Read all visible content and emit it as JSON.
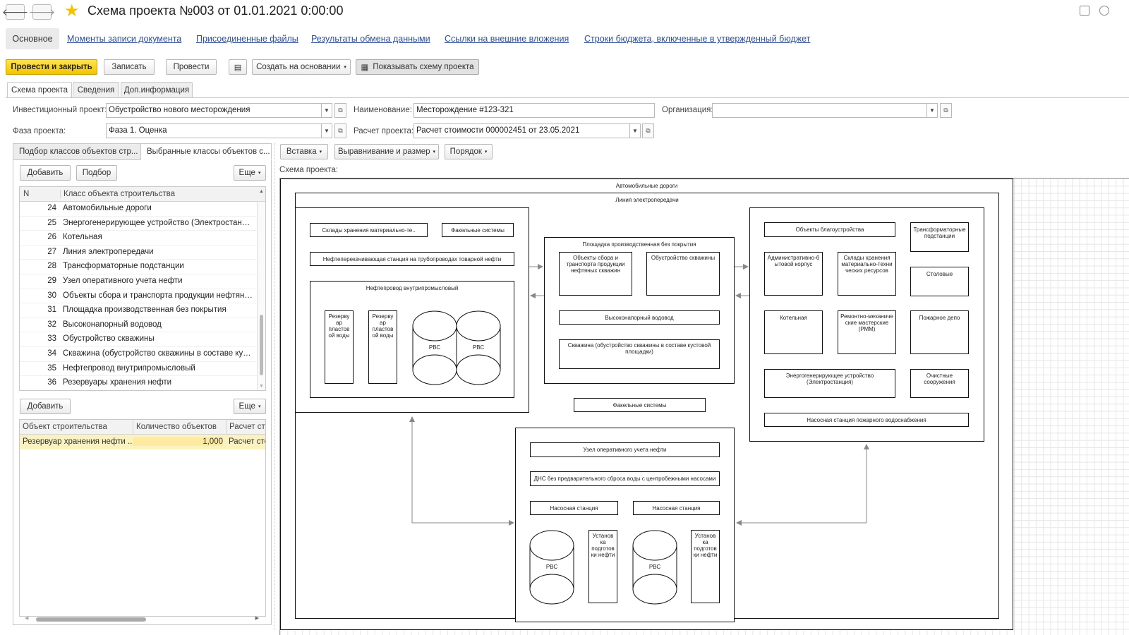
{
  "window": {
    "title": "Схема проекта №003 от 01.01.2021 0:00:00"
  },
  "top_tabs": {
    "active": "Основное",
    "links": [
      "Моменты записи документа",
      "Присоединенные файлы",
      "Результаты обмена данными",
      "Ссылки на внешние вложения",
      "Строки бюджета, включенные в утвержденный бюджет"
    ]
  },
  "toolbar": {
    "post_close": "Провести и закрыть",
    "save": "Записать",
    "post": "Провести",
    "create_based": "Создать на основании",
    "show_scheme": "Показывать схему проекта"
  },
  "form_tabs": [
    "Схема проекта",
    "Сведения",
    "Доп.информация"
  ],
  "fields": {
    "investment_project_label": "Инвестиционный проект:",
    "investment_project_value": "Обустройство нового месторождения",
    "name_label": "Наименование:",
    "name_value": "Месторождение #123-321",
    "org_label": "Организация:",
    "org_value": "",
    "phase_label": "Фаза проекта:",
    "phase_value": "Фаза 1. Оценка",
    "calc_label": "Расчет проекта:",
    "calc_value": "Расчет стоимости 000002451 от 23.05.2021"
  },
  "left_panel": {
    "tabs": [
      "Подбор классов объектов стр...",
      "Выбранные классы объектов с..."
    ],
    "add": "Добавить",
    "pick": "Подбор",
    "more": "Еще",
    "grid_headers": [
      "N",
      "Класс объекта строительства"
    ],
    "rows": [
      {
        "n": "24",
        "name": "Автомобильные дороги"
      },
      {
        "n": "25",
        "name": "Энергогенерирующее устройство (Электростанция)"
      },
      {
        "n": "26",
        "name": "Котельная"
      },
      {
        "n": "27",
        "name": "Линия электропередачи"
      },
      {
        "n": "28",
        "name": "Трансформаторные подстанции"
      },
      {
        "n": "29",
        "name": "Узел оперативного учета нефти"
      },
      {
        "n": "30",
        "name": "Объекты сбора и транспорта продукции нефтяных..."
      },
      {
        "n": "31",
        "name": "Площадка производственная без покрытия"
      },
      {
        "n": "32",
        "name": "Высоконапорный водовод"
      },
      {
        "n": "33",
        "name": "Обустройство скважины"
      },
      {
        "n": "34",
        "name": "Скважина (обустройство скважины в составе кус..."
      },
      {
        "n": "35",
        "name": "Нефтепровод внутрипромысловый"
      },
      {
        "n": "36",
        "name": "Резервуары хранения нефти"
      }
    ],
    "add2": "Добавить",
    "more2": "Еще",
    "grid2_headers": [
      "Объект строительства",
      "Количество объектов",
      "Расчет стс"
    ],
    "grid2_row": {
      "object": "Резервуар хранения нефти ...",
      "qty": "1,000",
      "calc": "Расчет стс"
    }
  },
  "diagram_toolbar": {
    "insert": "Вставка",
    "align": "Выравнивание и размер",
    "order": "Порядок",
    "caption": "Схема проекта:"
  },
  "diagram": {
    "roads": "Автомобильные дороги",
    "power_line": "Линия электропередачи",
    "warehouses": "Склады хранения материально-те..",
    "flare1": "Факельные системы",
    "pump_station_trunk": "Нефтеперекачивающая станция на трубопроводах товарной нефти",
    "pipeline": "Нефтепровод внутрипромысловый",
    "tank_reservoir": "Резерву ар пластов ой воды",
    "rvs": "РВС",
    "platform": "Площадка производственная без покрытия",
    "collection": "Объекты сбора и транспорта продукции нефтяных скважин",
    "well_setup": "Обустройство скважины",
    "hp_water": "Высоконапорный водовод",
    "well_cluster": "Скважина (обустройство скважины в составе кустовой площадки)",
    "flare2": "Факельные системы",
    "amenities": "Объекты благоустройства",
    "transformers": "Трансформаторные подстанции",
    "admin": "Административно-б ытовой корпус",
    "warehouses2": "Склады хранения материально-техни ческих ресурсов",
    "canteen": "Столовые",
    "boiler": "Котельная",
    "repair": "Ремонтно-механиче ские мастерские (РММ)",
    "fire": "Пожарное депо",
    "power_plant": "Энергогенерирующее устройство (Электростанция)",
    "treatment": "Очистные сооружения",
    "fire_pump": "Насосная станция пожарного водоснабжения",
    "metering": "Узел оперативного учета нефти",
    "dns": "ДНС без предварительного сброса воды с центробежными насосами",
    "pump1": "Насосная станция",
    "pump2": "Насосная станция",
    "oil_prep1": "Установ ка подготов ки нефти",
    "oil_prep2": "Установ ка подготов ки нефти"
  }
}
